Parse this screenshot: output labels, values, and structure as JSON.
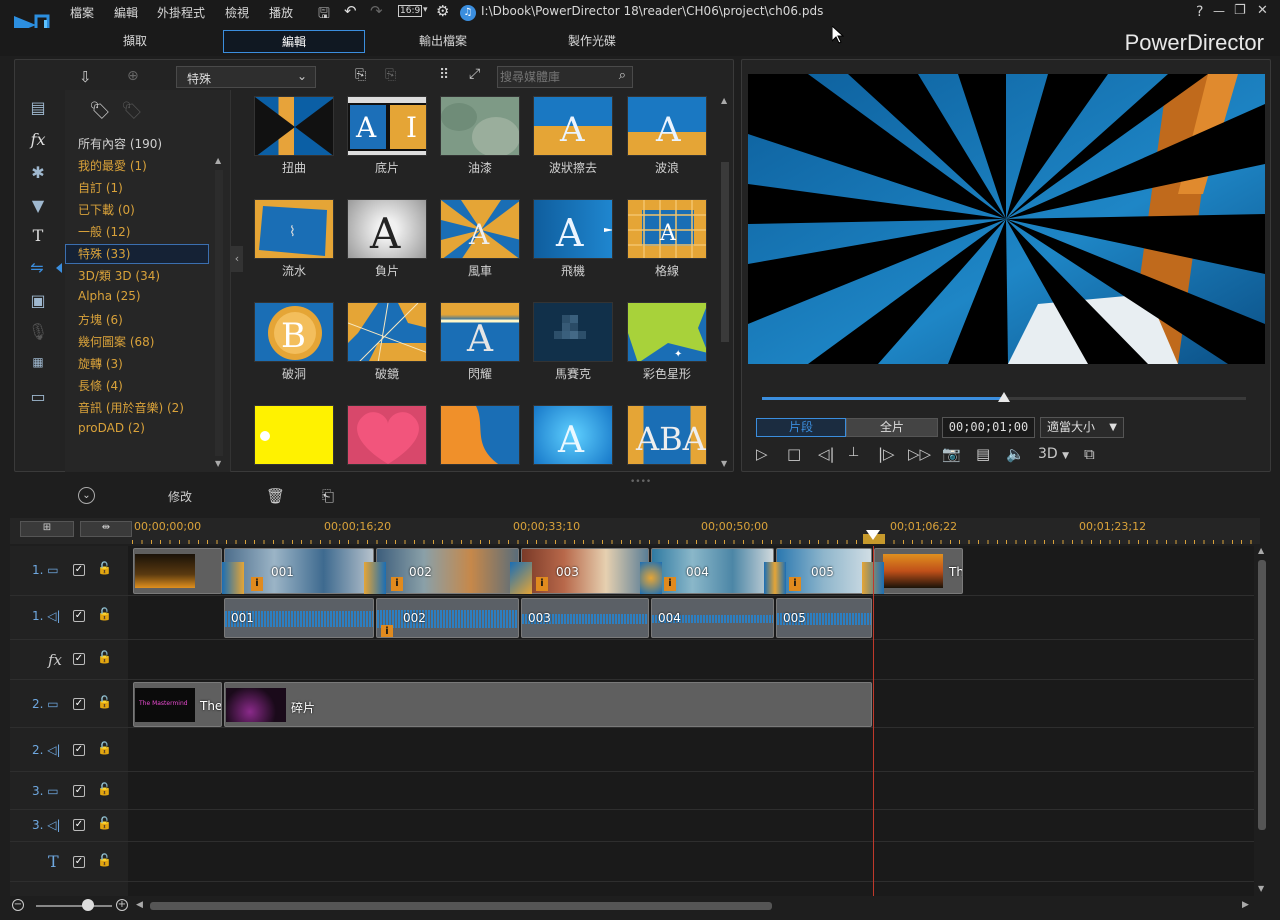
{
  "titlebar": {
    "menus": [
      "檔案",
      "編輯",
      "外掛程式",
      "檢視",
      "播放"
    ],
    "ratio": "16:9",
    "path": "I:\\Dbook\\PowerDirector 18\\reader\\CH06\\project\\ch06.pds",
    "help": "?",
    "minimize": "—",
    "restore": "❐",
    "close": "✕"
  },
  "modes": {
    "capture": "擷取",
    "edit": "編輯",
    "produce": "輸出檔案",
    "disc": "製作光碟"
  },
  "brand": "PowerDirector",
  "library": {
    "dropdown_value": "特殊",
    "search_placeholder": "搜尋媒體庫",
    "categories": [
      "所有內容 (190)",
      "我的最愛 (1)",
      "自訂 (1)",
      "已下載 (0)",
      "一般 (12)",
      "特殊 (33)",
      "3D/類 3D (34)",
      "Alpha (25)",
      "方塊 (6)",
      "幾何圖案 (68)",
      "旋轉 (3)",
      "長條 (4)",
      "音訊 (用於音樂) (2)",
      "proDAD (2)"
    ],
    "transitions": [
      "扭曲",
      "底片",
      "油漆",
      "波狀擦去",
      "波浪",
      "流水",
      "負片",
      "風車",
      "飛機",
      "格線",
      "破洞",
      "破鏡",
      "閃耀",
      "馬賽克",
      "彩色星形"
    ]
  },
  "preview": {
    "mode_clip": "片段",
    "mode_movie": "全片",
    "timecode": "00;00;01;00",
    "fit": "適當大小",
    "threed": "3D",
    "scrub_fraction": 0.5
  },
  "timeline_toolbar": {
    "modify": "修改"
  },
  "ruler": [
    "00;00;00;00",
    "00;00;16;20",
    "00;00;33;10",
    "00;00;50;00",
    "00;01;06;22",
    "00;01;23;12"
  ],
  "tracks": {
    "v1": "1.",
    "a1": "1.",
    "fx": "fx",
    "v2": "2.",
    "a2": "2.",
    "v3": "3.",
    "a3": "3."
  },
  "clips": {
    "video": [
      "001",
      "002",
      "003",
      "004",
      "005"
    ],
    "audio": [
      "001",
      "002",
      "003",
      "004",
      "005"
    ],
    "title_tail": "Th",
    "v2_title": "The",
    "v2_clip": "碎片"
  },
  "colors": {
    "accent": "#3b8ede",
    "orange": "#d9a23a",
    "playhead": "#c0392b"
  }
}
